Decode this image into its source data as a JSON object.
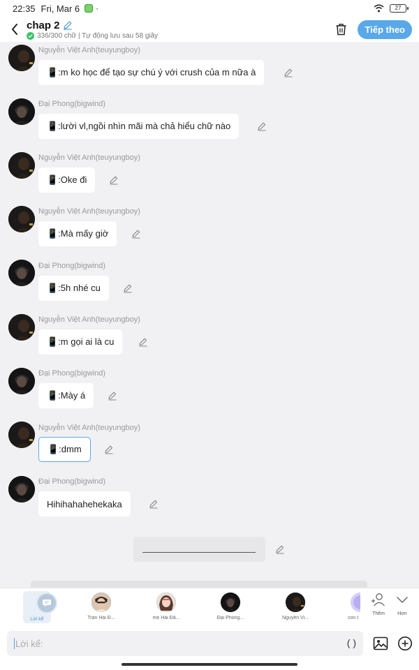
{
  "status_bar": {
    "time": "22:35",
    "date": "Fri, Mar 6",
    "dot": "·",
    "battery": "27"
  },
  "header": {
    "title": "chap 2",
    "subtitle": "336/300 chữ | Tự động lưu sau 58 giây",
    "next_label": "Tiếp theo"
  },
  "messages": [
    {
      "sender": "Nguyễn Việt Anh(teuyungboy)",
      "text": "📱:m ko học để tạo sự chú ý với crush của m nữa à"
    },
    {
      "sender": "Đại Phong(bigwind)",
      "text": "📱:lười vl,ngồi nhìn mãi mà chả hiểu chữ nào"
    },
    {
      "sender": "Nguyễn Việt Anh(teuyungboy)",
      "text": "📱:Oke đi"
    },
    {
      "sender": "Nguyễn Việt Anh(teuyungboy)",
      "text": "📱:Mà mấy giờ"
    },
    {
      "sender": "Đại Phong(bigwind)",
      "text": "📱:5h nhé cu"
    },
    {
      "sender": "Nguyễn Việt Anh(teuyungboy)",
      "text": "📱:m gọi ai là cu"
    },
    {
      "sender": "Đại Phong(bigwind)",
      "text": "📱:Mày á"
    },
    {
      "sender": "Nguyễn Việt Anh(teuyungboy)",
      "text": "📱:dmm"
    },
    {
      "sender": "Đại Phong(bigwind)",
      "text": "Hihihahahehekaka"
    }
  ],
  "characters": [
    {
      "label": "Lời kể"
    },
    {
      "label": "Trần Hải Đ..."
    },
    {
      "label": "mẹ Hải Đă..."
    },
    {
      "label": "Đại Phong..."
    },
    {
      "label": "Nguyễn Vi..."
    },
    {
      "label": "con t"
    }
  ],
  "side_buttons": {
    "add_label": "Thêm",
    "more_label": "Hơn"
  },
  "input": {
    "placeholder": "Lời kể:",
    "paren": "( )"
  },
  "colors": {
    "accent": "#58a8ea",
    "selected_border": "#5aa8e8",
    "saved_check": "#3cc26b"
  }
}
